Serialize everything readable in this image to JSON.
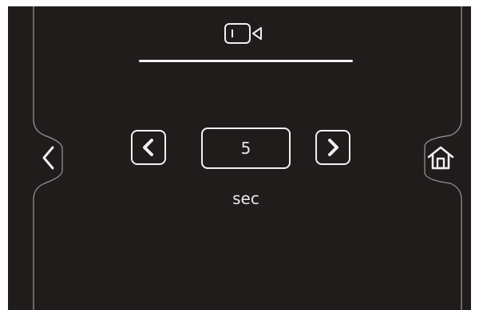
{
  "header": {
    "mode_icon": "video-camera-icon"
  },
  "setting": {
    "value": "5",
    "unit": "sec"
  },
  "controls": {
    "decrement_icon": "chevron-left-icon",
    "increment_icon": "chevron-right-icon"
  },
  "navigation": {
    "back_icon": "back-arrow-icon",
    "home_icon": "home-icon"
  },
  "colors": {
    "background": "#201c1b",
    "foreground": "#f0f0f0",
    "frame_line": "#9a9a9a"
  }
}
